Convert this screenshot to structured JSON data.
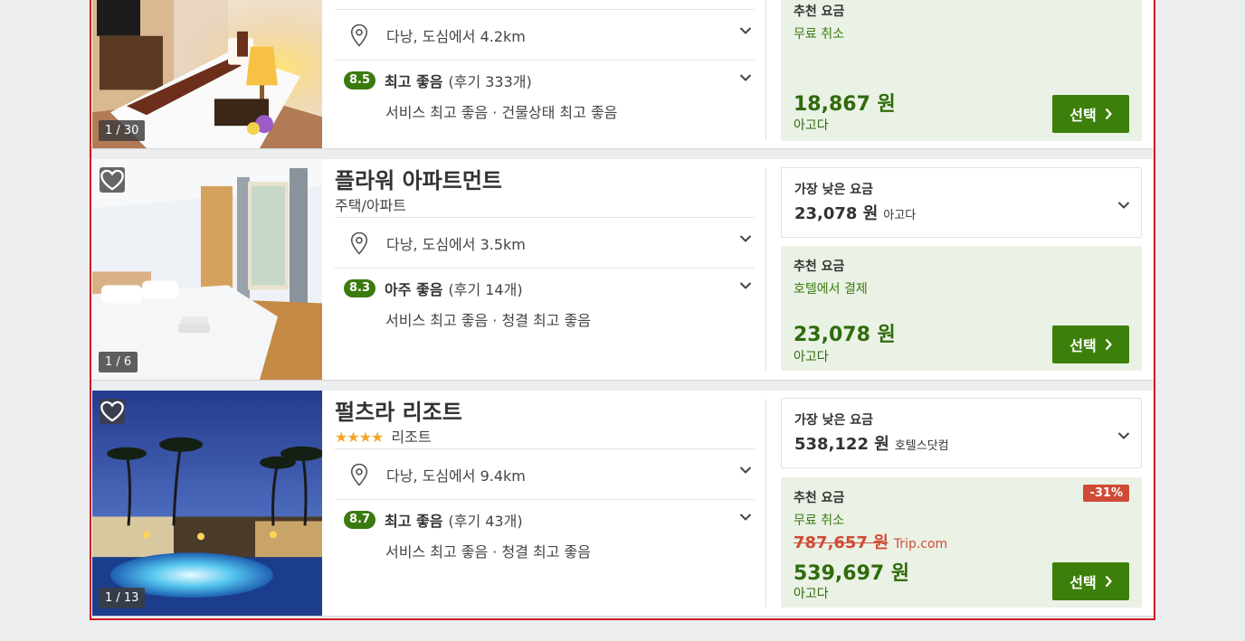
{
  "listings": [
    {
      "photo_counter": "1 / 30",
      "location": "다낭, 도심에서 4.2km",
      "score": "8.5",
      "review_label": "최고 좋음",
      "review_count": "(후기 333개)",
      "review_detail": "서비스 최고 좋음 · 건물상태 최고 좋음",
      "recommended": {
        "label": "추천 요금",
        "policy": "무료 취소",
        "price": "18,867 원",
        "vendor": "아고다",
        "button": "선택"
      }
    },
    {
      "name": "플라워 아파트먼트",
      "type": "주택/아파트",
      "photo_counter": "1 / 6",
      "location": "다낭, 도심에서 3.5km",
      "score": "8.3",
      "review_label": "아주 좋음",
      "review_count": "(후기 14개)",
      "review_detail": "서비스 최고 좋음 · 청결 최고 좋음",
      "lowest": {
        "label": "가장 낮은 요금",
        "price": "23,078 원",
        "vendor": "아고다"
      },
      "recommended": {
        "label": "추천 요금",
        "policy": "호텔에서 결제",
        "price": "23,078 원",
        "vendor": "아고다",
        "button": "선택"
      }
    },
    {
      "name": "펄츠라 리조트",
      "stars": "★★★★",
      "type": "리조트",
      "photo_counter": "1 / 13",
      "location": "다낭, 도심에서 9.4km",
      "score": "8.7",
      "review_label": "최고 좋음",
      "review_count": "(후기 43개)",
      "review_detail": "서비스 최고 좋음 · 청결 최고 좋음",
      "lowest": {
        "label": "가장 낮은 요금",
        "price": "538,122 원",
        "vendor": "호텔스닷컴"
      },
      "recommended": {
        "label": "추천 요금",
        "policy": "무료 취소",
        "discount": "-31%",
        "old_price": "787,657 원",
        "old_vendor": "Trip.com",
        "price": "539,697 원",
        "vendor": "아고다",
        "button": "선택"
      }
    }
  ],
  "colors": {
    "accent_green": "#3d7f0b",
    "recommended_bg": "#eaf1e5",
    "discount_red": "#d04b36",
    "highlight_border": "#d0191f"
  },
  "icons": [
    "location-pin-icon",
    "chevron-down-icon",
    "heart-icon",
    "chevron-right-icon"
  ]
}
